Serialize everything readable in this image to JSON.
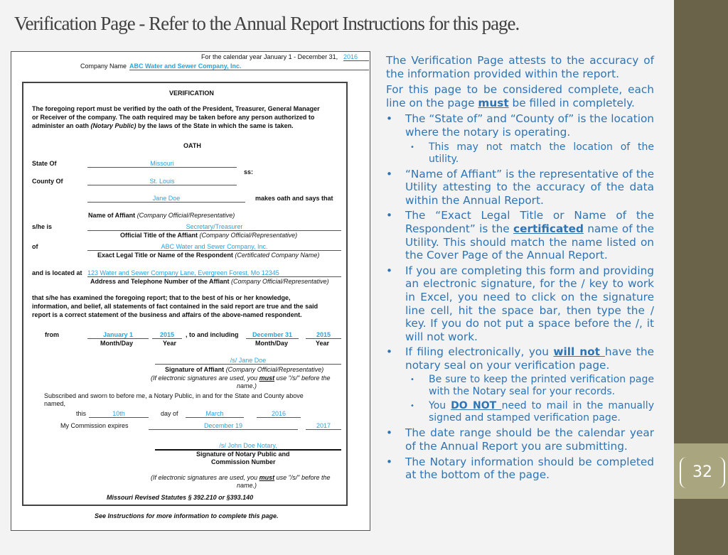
{
  "slide": {
    "title": "Verification Page - Refer to the Annual Report Instructions  for this page.",
    "page_number": "32"
  },
  "form": {
    "calendar_year_label": "For the calendar year January 1 - December 31,",
    "calendar_year": "2016",
    "company_name_label": "Company Name",
    "company_name": "ABC Water and Sewer Company, Inc.",
    "verification_heading": "VERIFICATION",
    "intro_1": "The foregoing report must be verified by the oath of the President, Treasurer, General Manager",
    "intro_2": "or Receiver of the company. The oath required may be taken before any person authorized to",
    "intro_3a": "administer an oath ",
    "intro_3b": "(Notary Public)",
    "intro_3c": " by the laws of the State in which the same is taken.",
    "oath_heading": "OATH",
    "state_label": "State Of",
    "state": "Missouri",
    "ss": "ss:",
    "county_label": "County Of",
    "county": "St. Louis",
    "affiant": "Jane Doe",
    "makes_oath": "makes oath and says that",
    "affiant_caption": "Name of Affiant",
    "rep_caption": "(Company Official/Representative)",
    "she_is_label": "s/he is",
    "title_value": "Secretary/Treasurer",
    "title_caption": "Official Title of the Affiant",
    "of_label": "of",
    "respondent": "ABC Water and Sewer Company, Inc.",
    "respondent_caption": "Exact Legal Title or Name of the Respondent",
    "respondent_note": "(Certificated Company Name)",
    "located_label": "and is located at",
    "address": "123 Water and Sewer Company Lane, Evergreen Forest, Mo 12345",
    "address_caption": "Address and Telephone Number of the Affiant",
    "stmt_1": "that s/he has examined the foregoing report; that to the best of his or her knowledge,",
    "stmt_2": "information, and belief, all statements of fact contained in the said report are true and the said",
    "stmt_3": "report is a correct statement of the business and affairs of the above-named respondent.",
    "from_label": "from",
    "from_day": "January 1",
    "from_year": "2015",
    "to_label": ", to and including",
    "to_day": "December 31",
    "to_year": "2015",
    "month_day": "Month/Day",
    "year": "Year",
    "signature": "/s/ Jane Doe",
    "signature_caption": "Signature of Affiant",
    "esig_1": "(If electronic signatures are used, you ",
    "esig_must": "must",
    "esig_2": " use  \"/s/\"  before the",
    "esig_3": "name.)",
    "sworn_1": "Subscribed and sworn to before me, a Notary Public, in and for the State and County above",
    "sworn_2": "named,",
    "this_label": "this",
    "day": "10th",
    "day_of": "day of",
    "month": "March",
    "notary_year": "2016",
    "commission_label": "My Commission expires",
    "commission_date": "December 19",
    "commission_year": "2017",
    "notary_signature": "/s/ John Doe Notary,",
    "notary_caption_1": "Signature of Notary Public and",
    "notary_caption_2": "Commission Number",
    "statutes": "Missouri Revised Statutes § 392.210 or §393.140",
    "see_instructions": "See Instructions for more information to complete this page."
  },
  "notes": {
    "p1": "The Verification Page attests to the accuracy of the information provided within the report.",
    "p2a": "For this page to be considered complete, each line on the page ",
    "p2b": "must",
    "p2c": " be filled in completely.",
    "b1": "The “State of” and “County of” is the location where the notary is operating.",
    "b1s1": "This may not match the location of the utility.",
    "b2": "“Name of Affiant” is the representative of the Utility attesting to the accuracy of the data within the Annual Report.",
    "b3a": "The “Exact Legal Title or Name of the Respondent” is the ",
    "b3b": "certificated",
    "b3c": " name of the Utility. This should match the name listed on the Cover Page of the Annual Report.",
    "b4": "If you are completing this form and providing an electronic signature, for the / key to work in Excel, you need to click on the signature line cell, hit the space bar, then type the / key. If you do not put a space before the /, it will not work.",
    "b5a": "If filing electronically, you ",
    "b5b": "will not ",
    "b5c": "have the notary seal on your verification page.",
    "b5s1": "Be sure to keep the printed verification page with the Notary seal for your records.",
    "b5s2a": "You ",
    "b5s2b": "DO NOT ",
    "b5s2c": "need to mail in the manually signed and stamped verification page.",
    "b6": "The date range should be the calendar year of the Annual Report you are submitting.",
    "b7": "The Notary information should be completed at the bottom of the page."
  }
}
